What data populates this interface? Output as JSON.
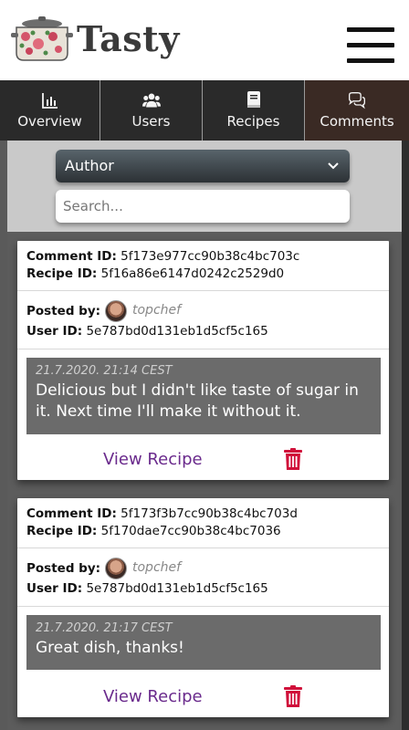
{
  "brand": {
    "name": "Tasty"
  },
  "nav": {
    "items": [
      {
        "label": "Overview",
        "icon": "bar-chart-icon"
      },
      {
        "label": "Users",
        "icon": "users-icon"
      },
      {
        "label": "Recipes",
        "icon": "book-icon"
      },
      {
        "label": "Comments",
        "icon": "comments-icon"
      }
    ],
    "active": "Comments",
    "active_color": "#3a2a24"
  },
  "filter": {
    "selected": "Author",
    "search_placeholder": "Search..."
  },
  "comments": [
    {
      "comment_id_label": "Comment ID:",
      "comment_id": "5f173e977cc90b38c4bc703c",
      "recipe_id_label": "Recipe ID:",
      "recipe_id": "5f16a86e6147d0242c2529d0",
      "posted_by_label": "Posted by:",
      "username": "topchef",
      "user_id_label": "User ID:",
      "user_id": "5e787bd0d131eb1d5cf5c165",
      "timestamp": "21.7.2020. 21:14 CEST",
      "text": "Delicious but I didn't like taste of sugar in it. Next time I'll make it without it.",
      "view_label": "View Recipe"
    },
    {
      "comment_id_label": "Comment ID:",
      "comment_id": "5f173f3b7cc90b38c4bc703d",
      "recipe_id_label": "Recipe ID:",
      "recipe_id": "5f170dae7cc90b38c4bc7036",
      "posted_by_label": "Posted by:",
      "username": "topchef",
      "user_id_label": "User ID:",
      "user_id": "5e787bd0d131eb1d5cf5c165",
      "timestamp": "21.7.2020. 21:17 CEST",
      "text": "Great dish, thanks!",
      "view_label": "View Recipe"
    }
  ],
  "colors": {
    "accent_link": "#6a2a8c",
    "delete": "#d0103a"
  }
}
